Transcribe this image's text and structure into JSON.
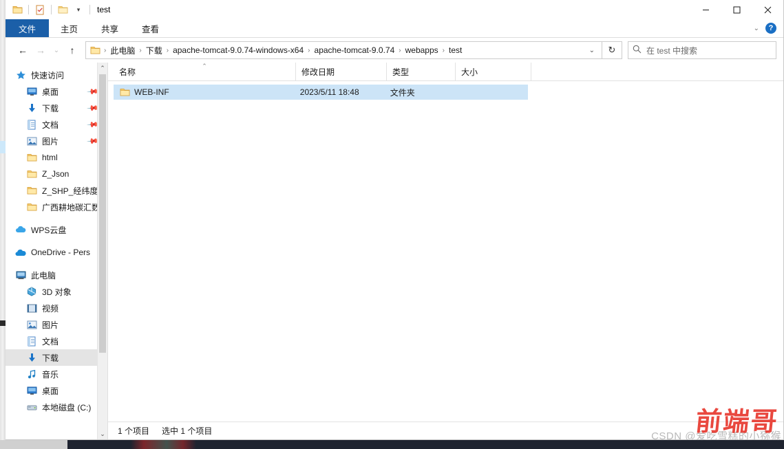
{
  "window": {
    "title": "test",
    "quick_access_icons": [
      "folder-icon",
      "properties-icon",
      "new-folder-icon"
    ],
    "qat_dropdown": "▾",
    "minimize_label": "—",
    "maximize_label": "▢",
    "close_label": "✕",
    "help_label": "?",
    "ribbon_expand": "⌄"
  },
  "ribbon": {
    "tabs": [
      {
        "label": "文件",
        "active": true
      },
      {
        "label": "主页",
        "active": false
      },
      {
        "label": "共享",
        "active": false
      },
      {
        "label": "查看",
        "active": false
      }
    ]
  },
  "address": {
    "back": "←",
    "forward": "→",
    "recent": "⌄",
    "up": "↑",
    "crumbs": [
      "此电脑",
      "下载",
      "apache-tomcat-9.0.74-windows-x64",
      "apache-tomcat-9.0.74",
      "webapps",
      "test"
    ],
    "separator": "›",
    "dropdown": "⌄",
    "refresh": "↻",
    "search_placeholder": "在 test 中搜索",
    "search_value": ""
  },
  "sidebar": {
    "scroll_up": "⌃",
    "scroll_down": "⌄",
    "groups": [
      {
        "root": {
          "label": "快速访问",
          "icon": "star-icon"
        },
        "items": [
          {
            "label": "桌面",
            "icon": "desktop-icon",
            "pinned": true
          },
          {
            "label": "下载",
            "icon": "download-icon",
            "pinned": true
          },
          {
            "label": "文档",
            "icon": "documents-icon",
            "pinned": true
          },
          {
            "label": "图片",
            "icon": "pictures-icon",
            "pinned": true
          },
          {
            "label": "html",
            "icon": "folder-icon",
            "pinned": false
          },
          {
            "label": "Z_Json",
            "icon": "folder-icon",
            "pinned": false
          },
          {
            "label": "Z_SHP_经纬度",
            "icon": "folder-icon",
            "pinned": false
          },
          {
            "label": "广西耕地碳汇数",
            "icon": "folder-icon",
            "pinned": false
          }
        ]
      },
      {
        "root": {
          "label": "WPS云盘",
          "icon": "cloud-icon"
        },
        "items": []
      },
      {
        "root": {
          "label": "OneDrive - Pers",
          "icon": "onedrive-icon"
        },
        "items": []
      },
      {
        "root": {
          "label": "此电脑",
          "icon": "this-pc-icon"
        },
        "items": [
          {
            "label": "3D 对象",
            "icon": "3d-objects-icon",
            "selected": false
          },
          {
            "label": "视频",
            "icon": "videos-icon",
            "selected": false
          },
          {
            "label": "图片",
            "icon": "pictures-icon",
            "selected": false
          },
          {
            "label": "文档",
            "icon": "documents-icon",
            "selected": false
          },
          {
            "label": "下载",
            "icon": "download-icon",
            "selected": true
          },
          {
            "label": "音乐",
            "icon": "music-icon",
            "selected": false
          },
          {
            "label": "桌面",
            "icon": "desktop-icon",
            "selected": false
          },
          {
            "label": "本地磁盘 (C:)",
            "icon": "drive-icon",
            "selected": false
          }
        ]
      }
    ]
  },
  "file_list": {
    "columns": [
      {
        "key": "name",
        "label": "名称",
        "sorted": true,
        "sort_caret": "⌃"
      },
      {
        "key": "date",
        "label": "修改日期",
        "sorted": false
      },
      {
        "key": "type",
        "label": "类型",
        "sorted": false
      },
      {
        "key": "size",
        "label": "大小",
        "sorted": false
      }
    ],
    "rows": [
      {
        "name": "WEB-INF",
        "date": "2023/5/11 18:48",
        "type": "文件夹",
        "size": "",
        "icon": "folder-icon",
        "selected": true
      }
    ]
  },
  "status_bar": {
    "item_count": "1 个项目",
    "selection": "选中 1 个项目"
  },
  "watermark": {
    "csdn_text": "CSDN @爱吃雪糕的小猕猴",
    "logo_text": "前端哥"
  },
  "colors": {
    "accent": "#1b5fa8",
    "selection": "#cce4f7",
    "nav_selected": "#e4e4e4",
    "watermark_red": "#e8392f",
    "taskbar": "#1f2430"
  }
}
